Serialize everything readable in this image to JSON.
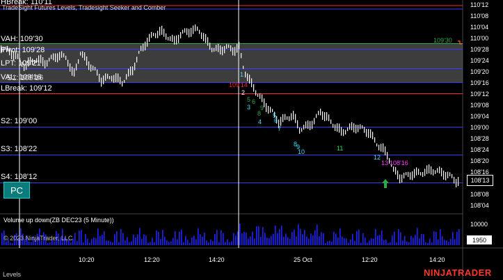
{
  "indicator_title": "TradeSight Futures Levels, Tradesight Seeker and Comber",
  "top_label": "HBreak: 110'11",
  "levels": [
    {
      "label": "VAH: 109'30",
      "price": 109.9375,
      "color": "#2ea84a"
    },
    {
      "label": "Pivot: 109'28",
      "price": 109.875,
      "color": "#3b3bff"
    },
    {
      "label": "LPT: 109'21",
      "price": 109.65625,
      "color": "#3b3bff"
    },
    {
      "label": "VAL: 109'16",
      "price": 109.5,
      "color": "#3b3bff"
    },
    {
      "label": "S1: 109'16",
      "price": 109.5,
      "color": "#3b3bff"
    },
    {
      "label": "LBreak: 109'12",
      "price": 109.375,
      "color": "#ff2a2a"
    },
    {
      "label": "S2: 109'00",
      "price": 109.0,
      "color": "#3b3bff"
    },
    {
      "label": "S3: 108'22",
      "price": 108.6875,
      "color": "#3b3bff"
    },
    {
      "label": "S4: 108'12",
      "price": 108.375,
      "color": "#3b3bff"
    }
  ],
  "price_axis_labels": [
    "110'12",
    "110'08",
    "110'04",
    "110'00",
    "109'28",
    "109'24",
    "109'20",
    "109'16",
    "109'12",
    "109'08",
    "109'04",
    "109'00",
    "108'28",
    "108'24",
    "108'20",
    "108'16",
    "108'12",
    "108'08",
    "108'04"
  ],
  "vah_right_label": "109'30",
  "current_price": "108'13",
  "pc_button": "PC",
  "volume_panel": {
    "title": "Volume up down(ZB DEC23 (5 Minute))",
    "copyright": "© 2023 NinjaTrader, LLC",
    "axis_label": "10000",
    "current_volume": "1950"
  },
  "time_axis_labels": [
    "10:20",
    "12:20",
    "14:20",
    "25 Oct",
    "12:20",
    "14:20"
  ],
  "footer_tab": "Levels",
  "brand": "NINJATRADER",
  "seeker_numbers": [
    {
      "text": "1",
      "color": "#3fe0ff"
    },
    {
      "text": "2",
      "color": "#ffffff"
    },
    {
      "text": "3",
      "color": "#3fe0ff"
    },
    {
      "text": "4",
      "color": "#3fe0ff"
    },
    {
      "text": "5",
      "color": "#3fe0ff"
    },
    {
      "text": "6",
      "color": "#3fe0ff"
    },
    {
      "text": "7",
      "color": "#3fe0ff"
    },
    {
      "text": "8",
      "color": "#3fe0ff"
    },
    {
      "text": "9",
      "color": "#3fe0ff"
    },
    {
      "text": "10",
      "color": "#3fe0ff"
    },
    {
      "text": "11",
      "color": "#2ee06a"
    },
    {
      "text": "12",
      "color": "#3fe0ff"
    },
    {
      "text": "13",
      "color": "#ff40ff"
    }
  ],
  "comber_numbers": [
    {
      "text": "5",
      "color": "#2ea84a"
    },
    {
      "text": "6",
      "color": "#2ea84a"
    },
    {
      "text": "8",
      "color": "#2ea84a"
    },
    {
      "text": "9",
      "color": "#2ea84a"
    }
  ],
  "annotations": [
    {
      "text": "109'14",
      "color": "#ff2a2a"
    },
    {
      "text": "108'16",
      "color": "#ff40ff"
    }
  ],
  "colors": {
    "up_bar": "#ffffff",
    "volume": "#2222ff",
    "cursor": "#ffffff",
    "arrow": "#2ea84a"
  }
}
